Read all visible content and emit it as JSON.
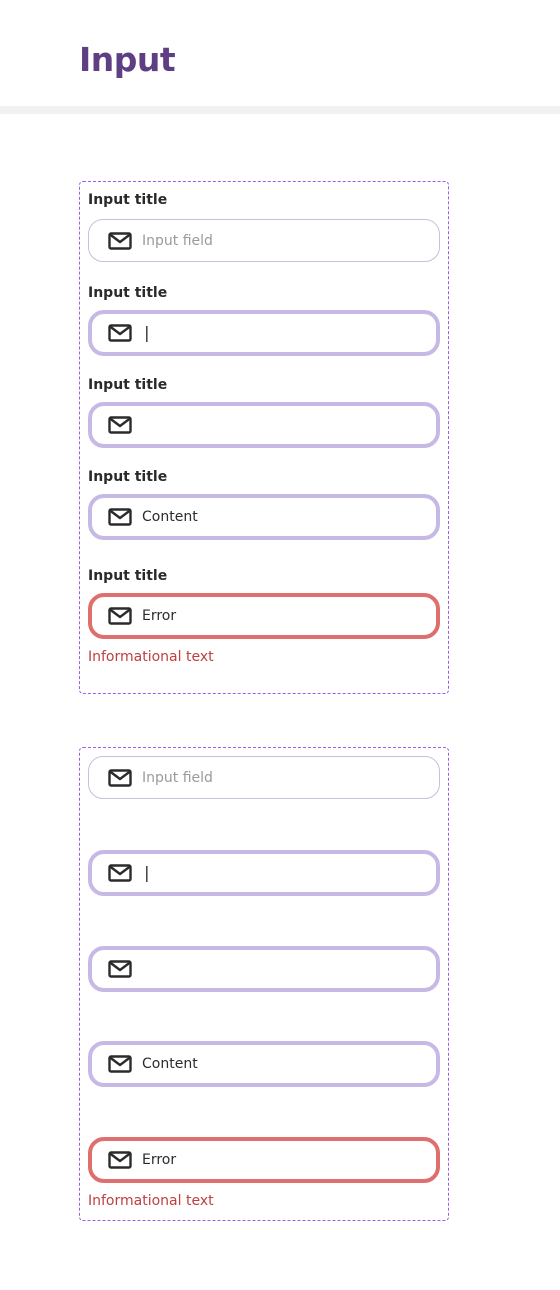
{
  "page": {
    "title": "Input"
  },
  "colors": {
    "title": "#5e3f84",
    "group_border": "#9b5cf0",
    "default_border": "#c8bfdc",
    "focus_border": "#c7b9e6",
    "error_border": "#de6f6e",
    "error_text": "#c0403f",
    "placeholder": "#9a9a9a"
  },
  "icons": {
    "field_icon": "mail-icon"
  },
  "group_with_titles": {
    "fields": [
      {
        "label": "Input title",
        "state": "default",
        "text": "Input field"
      },
      {
        "label": "Input title",
        "state": "typing",
        "text": "|"
      },
      {
        "label": "Input title",
        "state": "focused-empty",
        "text": ""
      },
      {
        "label": "Input title",
        "state": "filled",
        "text": "Content"
      },
      {
        "label": "Input title",
        "state": "error",
        "text": "Error",
        "helper": "Informational text"
      }
    ]
  },
  "group_without_titles": {
    "fields": [
      {
        "state": "default",
        "text": "Input field"
      },
      {
        "state": "typing",
        "text": "|"
      },
      {
        "state": "focused-empty",
        "text": ""
      },
      {
        "state": "filled",
        "text": "Content"
      },
      {
        "state": "error",
        "text": "Error",
        "helper": "Informational text"
      }
    ]
  }
}
